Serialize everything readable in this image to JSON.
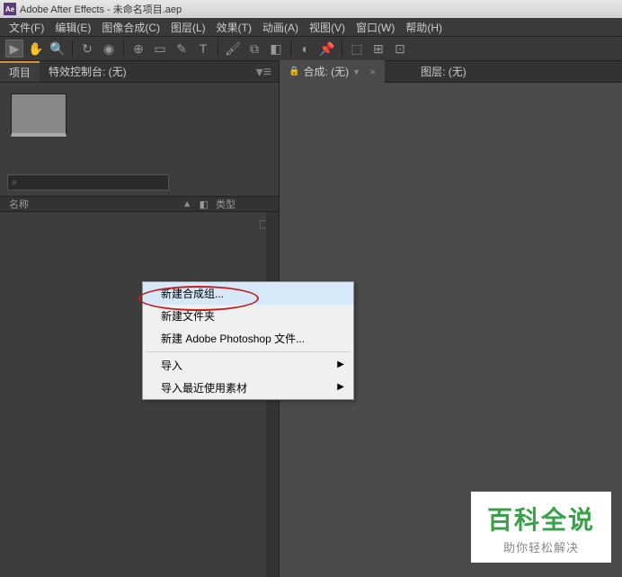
{
  "titlebar": {
    "app_icon": "Ae",
    "title": "Adobe After Effects - 未命名项目.aep"
  },
  "menubar": {
    "items": [
      "文件(F)",
      "编辑(E)",
      "图像合成(C)",
      "图层(L)",
      "效果(T)",
      "动画(A)",
      "视图(V)",
      "窗口(W)",
      "帮助(H)"
    ]
  },
  "left_panel": {
    "tabs": {
      "project": "项目",
      "effects": "特效控制台: (无)"
    },
    "search_placeholder": "",
    "columns": {
      "name": "名称",
      "type": "类型"
    }
  },
  "right_panel": {
    "tabs": {
      "comp": "合成: (无)",
      "layer": "图层: (无)"
    }
  },
  "context_menu": {
    "items": [
      "新建合成组...",
      "新建文件夹",
      "新建 Adobe Photoshop 文件...",
      "导入",
      "导入最近使用素材"
    ]
  },
  "watermark": {
    "title": "百科全说",
    "subtitle": "助你轻松解决"
  }
}
